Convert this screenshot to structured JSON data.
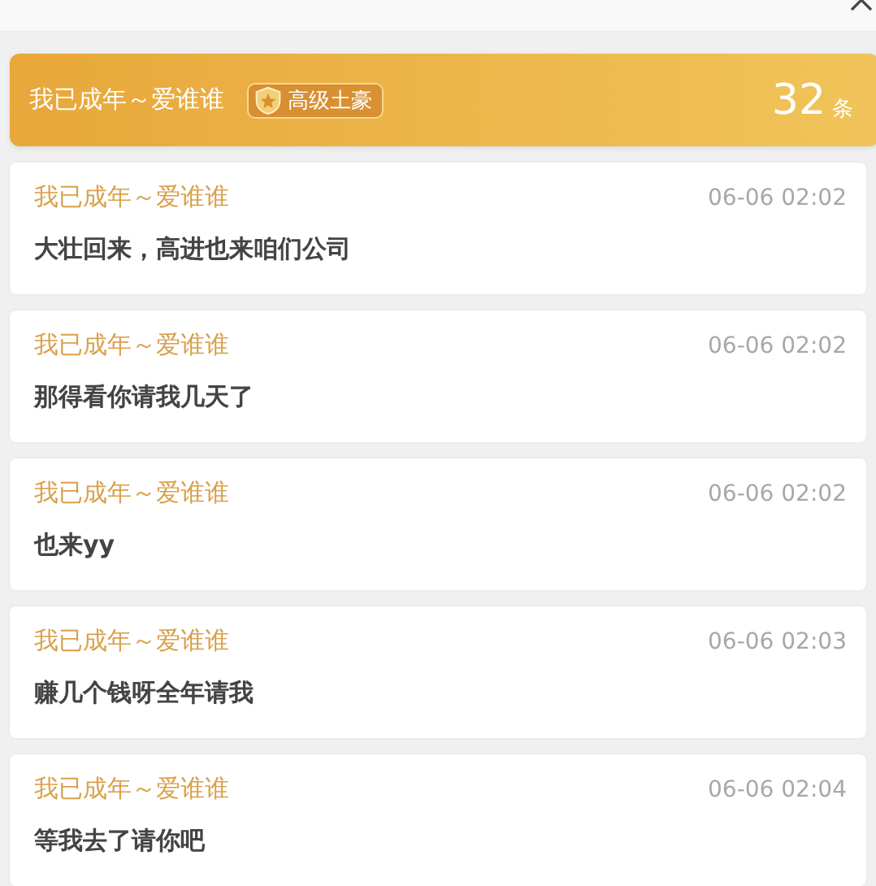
{
  "header": {
    "user": "我已成年～爱谁谁",
    "badge": "高级土豪",
    "count": "32",
    "count_unit": "条"
  },
  "messages": [
    {
      "user": "我已成年～爱谁谁",
      "time": "06-06 02:02",
      "text": "大壮回来，高进也来咱们公司"
    },
    {
      "user": "我已成年～爱谁谁",
      "time": "06-06 02:02",
      "text": "那得看你请我几天了"
    },
    {
      "user": "我已成年～爱谁谁",
      "time": "06-06 02:02",
      "text": "也来yy"
    },
    {
      "user": "我已成年～爱谁谁",
      "time": "06-06 02:03",
      "text": "赚几个钱呀全年请我"
    },
    {
      "user": "我已成年～爱谁谁",
      "time": "06-06 02:04",
      "text": "等我去了请你吧"
    }
  ]
}
